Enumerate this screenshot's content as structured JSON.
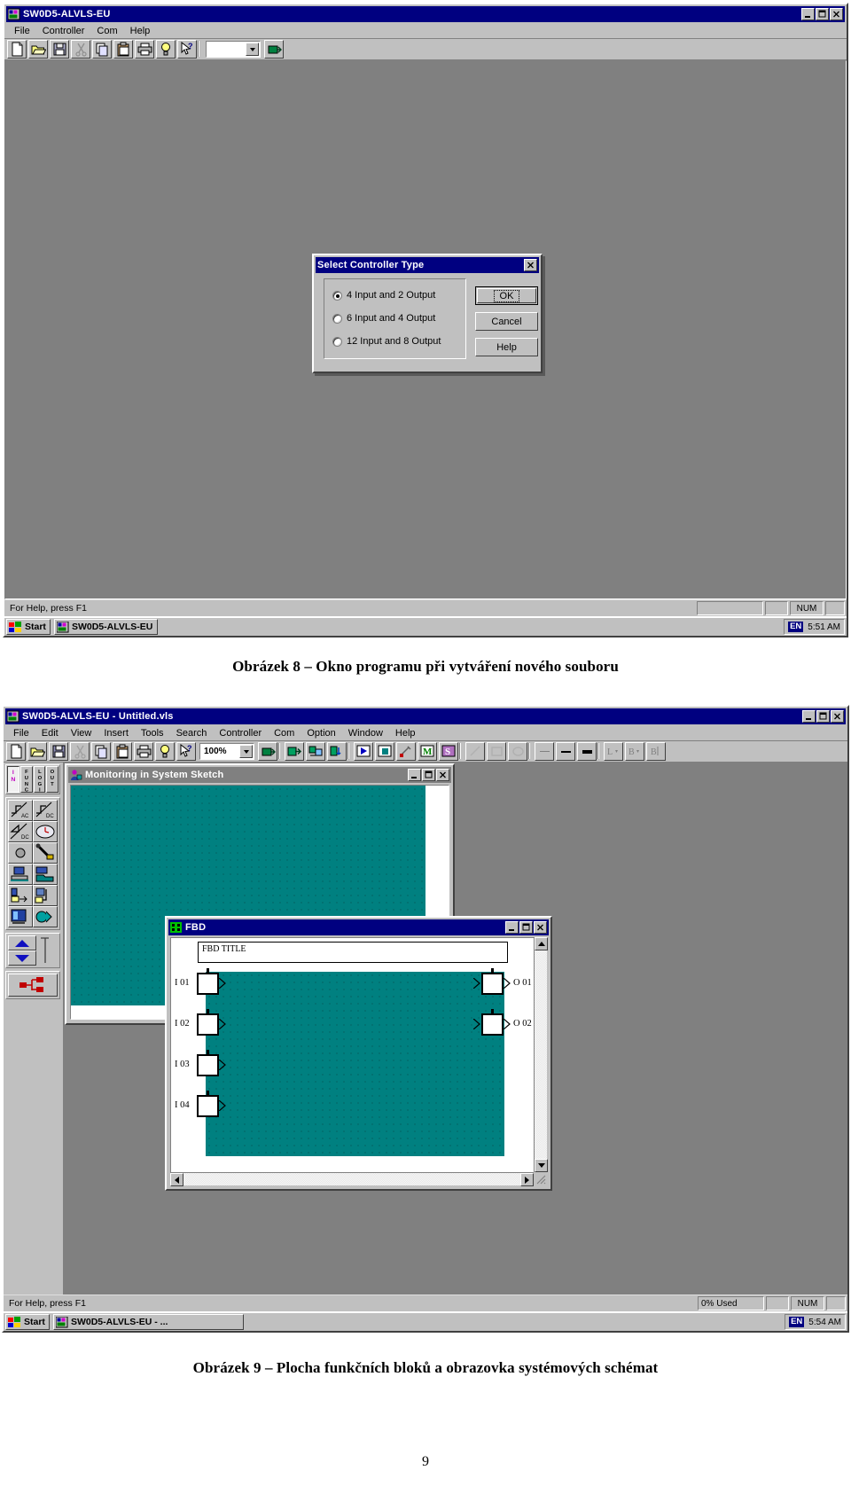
{
  "document": {
    "caption_8": "Obrázek 8 – Okno programu při vytváření nového souboru",
    "caption_9": "Obrázek 9 – Plocha funkčních bloků a obrazovka systémových schémat",
    "page_number": "9"
  },
  "shot1": {
    "window": {
      "title": "SW0D5-ALVLS-EU",
      "icon": "app-icon",
      "minimize": "_",
      "maximize": "□",
      "close": "×"
    },
    "menu": [
      {
        "label": "File",
        "accel": "F"
      },
      {
        "label": "Controller",
        "accel": "C"
      },
      {
        "label": "Com",
        "accel": "m"
      },
      {
        "label": "Help",
        "accel": "H"
      }
    ],
    "toolbar": {
      "buttons": [
        "new-icon",
        "open-icon",
        "save-icon",
        "cut-icon",
        "copy-icon",
        "paste-icon",
        "print-icon",
        "about-icon",
        "help-pointer-icon"
      ],
      "combo_value": "",
      "transfer_icon": "transfer-icon"
    },
    "dialog": {
      "title": "Select Controller Type",
      "close": "×",
      "options": [
        {
          "label": "4 Input and 2 Output",
          "accel": "4",
          "selected": true
        },
        {
          "label": "6 Input and 4 Output",
          "accel": "6",
          "selected": false
        },
        {
          "label": "12 Input and 8 Output",
          "accel": "12",
          "selected": false
        }
      ],
      "buttons": [
        {
          "label": "OK",
          "default": true
        },
        {
          "label": "Cancel",
          "default": false
        },
        {
          "label": "Help",
          "default": false
        }
      ]
    },
    "statusbar": {
      "hint": "For Help, press F1",
      "pane1": "",
      "pane2": "",
      "num": "NUM"
    },
    "taskbar": {
      "start": "Start",
      "tasks": [
        "SW0D5-ALVLS-EU"
      ],
      "lang": "EN",
      "clock": "5:51 AM"
    }
  },
  "shot2": {
    "window": {
      "title": "SW0D5-ALVLS-EU - Untitled.vls",
      "icon": "app-icon",
      "minimize": "_",
      "maximize": "□",
      "close": "×"
    },
    "menu": [
      {
        "label": "File",
        "accel": "F"
      },
      {
        "label": "Edit",
        "accel": "E"
      },
      {
        "label": "View",
        "accel": "V"
      },
      {
        "label": "Insert",
        "accel": "I"
      },
      {
        "label": "Tools",
        "accel": "T"
      },
      {
        "label": "Search",
        "accel": "S"
      },
      {
        "label": "Controller",
        "accel": "C"
      },
      {
        "label": "Com",
        "accel": "m"
      },
      {
        "label": "Option",
        "accel": "O"
      },
      {
        "label": "Window",
        "accel": "W"
      },
      {
        "label": "Help",
        "accel": "H"
      }
    ],
    "toolbar": {
      "group1": [
        "new-icon",
        "open-icon",
        "save-icon",
        "cut-icon",
        "copy-icon",
        "paste-icon",
        "print-icon",
        "about-icon",
        "help-pointer-icon"
      ],
      "zoom_value": "100%",
      "group2": [
        "transfer-icon"
      ],
      "group3": [
        "write-to-controller-icon",
        "verify-icon",
        "read-from-controller-icon"
      ],
      "group4": [
        "run-icon",
        "stop-icon",
        "tool-icon",
        "monitor-m-icon",
        "monitor-s-icon"
      ],
      "group5": [
        "line-icon",
        "rectangle-icon",
        "ellipse-icon"
      ],
      "group6": [
        "thin-line-icon",
        "medium-line-icon",
        "thick-line-icon"
      ],
      "group7": [
        "line-style-icon",
        "border-style-icon",
        "font-style-icon"
      ]
    },
    "side_tools": {
      "tabs": [
        "IN",
        "FUNC",
        "LOGI",
        "OUT"
      ],
      "blocks": [
        "input-ac-icon",
        "input-dc-icon",
        "analog-dc-icon",
        "clock-icon",
        "lamp-icon",
        "key-switch-icon",
        "controller-pc-icon",
        "folder-tool-icon",
        "dialog-out-icon",
        "branch-icon",
        "terminal-icon",
        "relay-icon"
      ],
      "nav": [
        "scroll-up-icon",
        "scroll-down-icon",
        "ruler-icon"
      ],
      "system_sketch_button": "system-sketch-icon"
    },
    "sketch_window": {
      "title": "Monitoring in System Sketch",
      "icon": "monitor-icon",
      "minimize": "_",
      "maximize": "□",
      "close": "×"
    },
    "fbd_window": {
      "title": "FBD",
      "icon": "fbd-icon",
      "minimize": "_",
      "maximize": "□",
      "close": "×",
      "title_field": "FBD TITLE",
      "inputs": [
        "I 01",
        "I 02",
        "I 03",
        "I 04"
      ],
      "outputs": [
        "O 01",
        "O 02"
      ]
    },
    "statusbar": {
      "hint": "For Help, press F1",
      "used": "0% Used",
      "pane2": "",
      "num": "NUM"
    },
    "taskbar": {
      "start": "Start",
      "tasks": [
        "SW0D5-ALVLS-EU - ..."
      ],
      "lang": "EN",
      "clock": "5:54 AM"
    }
  },
  "colors": {
    "titlebar_active": "#000080",
    "titlebar_inactive": "#808080",
    "face": "#c0c0c0",
    "workspace": "#808080",
    "canvas": "#008080"
  }
}
